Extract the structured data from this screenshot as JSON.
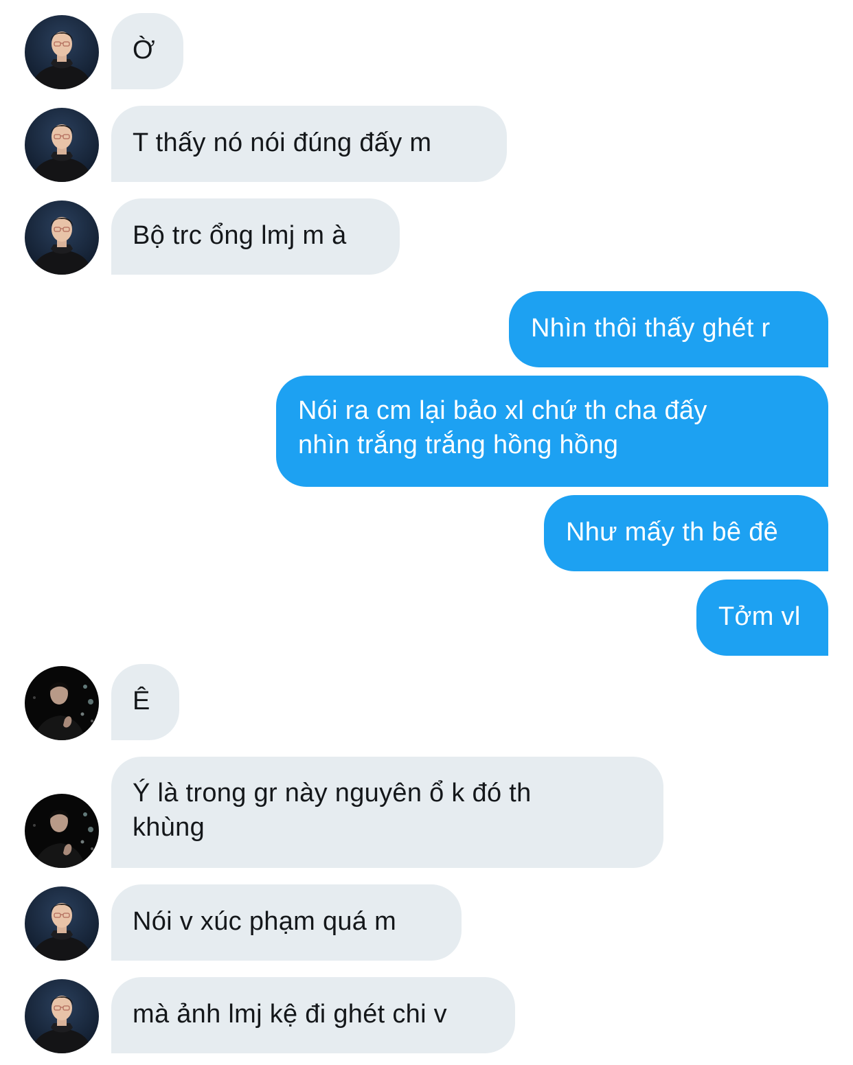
{
  "conversation": {
    "colors": {
      "incoming_bubble": "#e6ecf0",
      "incoming_text": "#14171a",
      "outgoing_bubble": "#1da1f2",
      "outgoing_text": "#ffffff"
    },
    "messages": [
      {
        "direction": "incoming",
        "avatar": "profile-photo-hoodie",
        "text": "Ờ"
      },
      {
        "direction": "incoming",
        "avatar": "profile-photo-hoodie",
        "text": "T thấy nó nói đúng đấy m"
      },
      {
        "direction": "incoming",
        "avatar": "profile-photo-hoodie",
        "text": "Bộ trc ổng lmj m à"
      },
      {
        "direction": "outgoing",
        "text": "Nhìn thôi thấy ghét r"
      },
      {
        "direction": "outgoing",
        "lines": [
          "Nói ra cm lại bảo xl chứ th cha đấy",
          "nhìn trắng trắng hồng hồng"
        ]
      },
      {
        "direction": "outgoing",
        "text": "Như mấy th bê đê"
      },
      {
        "direction": "outgoing",
        "text": "Tởm vl"
      },
      {
        "direction": "incoming",
        "avatar": "profile-photo-dark-bokeh",
        "text": "Ê"
      },
      {
        "direction": "incoming",
        "avatar": "profile-photo-dark-bokeh",
        "lines": [
          "Ý là trong gr này nguyên ổ k đó th",
          "khùng"
        ]
      },
      {
        "direction": "incoming",
        "avatar": "profile-photo-hoodie",
        "text": "Nói v xúc phạm quá m"
      },
      {
        "direction": "incoming",
        "avatar": "profile-photo-hoodie",
        "text": "mà ảnh lmj kệ đi ghét chi v"
      }
    ]
  }
}
